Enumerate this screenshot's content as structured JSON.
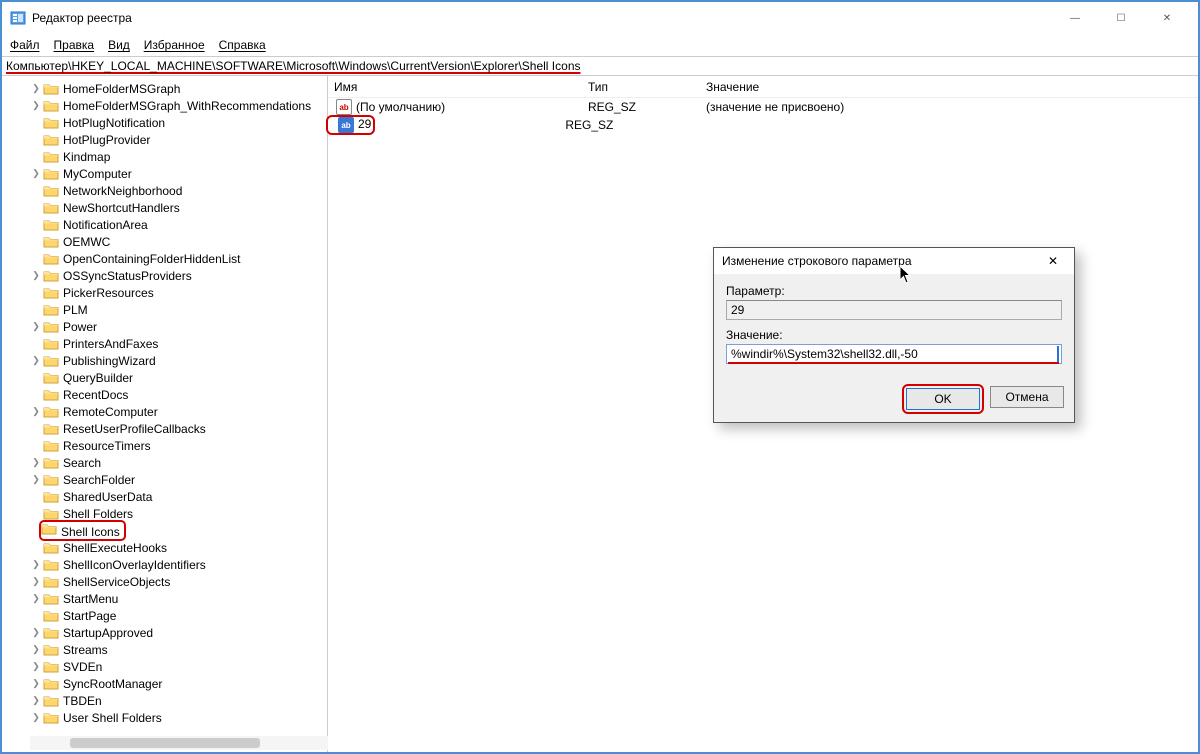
{
  "window": {
    "title": "Редактор реестра",
    "minimize": "—",
    "maximize": "☐",
    "close": "✕"
  },
  "menu": {
    "file": "Файл",
    "edit": "Правка",
    "view": "Вид",
    "favorites": "Избранное",
    "help": "Справка"
  },
  "address": "Компьютер\\HKEY_LOCAL_MACHINE\\SOFTWARE\\Microsoft\\Windows\\CurrentVersion\\Explorer\\Shell Icons",
  "tree": {
    "items": [
      {
        "exp": true,
        "label": "HomeFolderMSGraph"
      },
      {
        "exp": true,
        "label": "HomeFolderMSGraph_WithRecommendations"
      },
      {
        "exp": false,
        "label": "HotPlugNotification"
      },
      {
        "exp": false,
        "label": "HotPlugProvider"
      },
      {
        "exp": false,
        "label": "Kindmap"
      },
      {
        "exp": true,
        "label": "MyComputer"
      },
      {
        "exp": false,
        "label": "NetworkNeighborhood"
      },
      {
        "exp": false,
        "label": "NewShortcutHandlers"
      },
      {
        "exp": false,
        "label": "NotificationArea"
      },
      {
        "exp": false,
        "label": "OEMWC"
      },
      {
        "exp": false,
        "label": "OpenContainingFolderHiddenList"
      },
      {
        "exp": true,
        "label": "OSSyncStatusProviders"
      },
      {
        "exp": false,
        "label": "PickerResources"
      },
      {
        "exp": false,
        "label": "PLM"
      },
      {
        "exp": true,
        "label": "Power"
      },
      {
        "exp": false,
        "label": "PrintersAndFaxes"
      },
      {
        "exp": true,
        "label": "PublishingWizard"
      },
      {
        "exp": false,
        "label": "QueryBuilder"
      },
      {
        "exp": false,
        "label": "RecentDocs"
      },
      {
        "exp": true,
        "label": "RemoteComputer"
      },
      {
        "exp": false,
        "label": "ResetUserProfileCallbacks"
      },
      {
        "exp": false,
        "label": "ResourceTimers"
      },
      {
        "exp": true,
        "label": "Search"
      },
      {
        "exp": true,
        "label": "SearchFolder"
      },
      {
        "exp": false,
        "label": "SharedUserData"
      },
      {
        "exp": false,
        "label": "Shell Folders"
      },
      {
        "exp": false,
        "label": "Shell Icons",
        "selected": true
      },
      {
        "exp": false,
        "label": "ShellExecuteHooks"
      },
      {
        "exp": true,
        "label": "ShellIconOverlayIdentifiers"
      },
      {
        "exp": true,
        "label": "ShellServiceObjects"
      },
      {
        "exp": true,
        "label": "StartMenu"
      },
      {
        "exp": false,
        "label": "StartPage"
      },
      {
        "exp": true,
        "label": "StartupApproved"
      },
      {
        "exp": true,
        "label": "Streams"
      },
      {
        "exp": true,
        "label": "SVDEn"
      },
      {
        "exp": true,
        "label": "SyncRootManager"
      },
      {
        "exp": true,
        "label": "TBDEn"
      },
      {
        "exp": true,
        "label": "User Shell Folders"
      }
    ]
  },
  "list": {
    "headers": {
      "name": "Имя",
      "type": "Тип",
      "value": "Значение"
    },
    "rows": [
      {
        "icon": "ab",
        "name": "(По умолчанию)",
        "type": "REG_SZ",
        "value": "(значение не присвоено)",
        "selected": false,
        "highlighted": false
      },
      {
        "icon": "ab",
        "name": "29",
        "type": "REG_SZ",
        "value": "",
        "selected": true,
        "highlighted": true
      }
    ]
  },
  "dialog": {
    "title": "Изменение строкового параметра",
    "close": "✕",
    "param_label": "Параметр:",
    "param_value": "29",
    "value_label": "Значение:",
    "value_value": "%windir%\\System32\\shell32.dll,-50",
    "ok": "OK",
    "cancel": "Отмена"
  }
}
